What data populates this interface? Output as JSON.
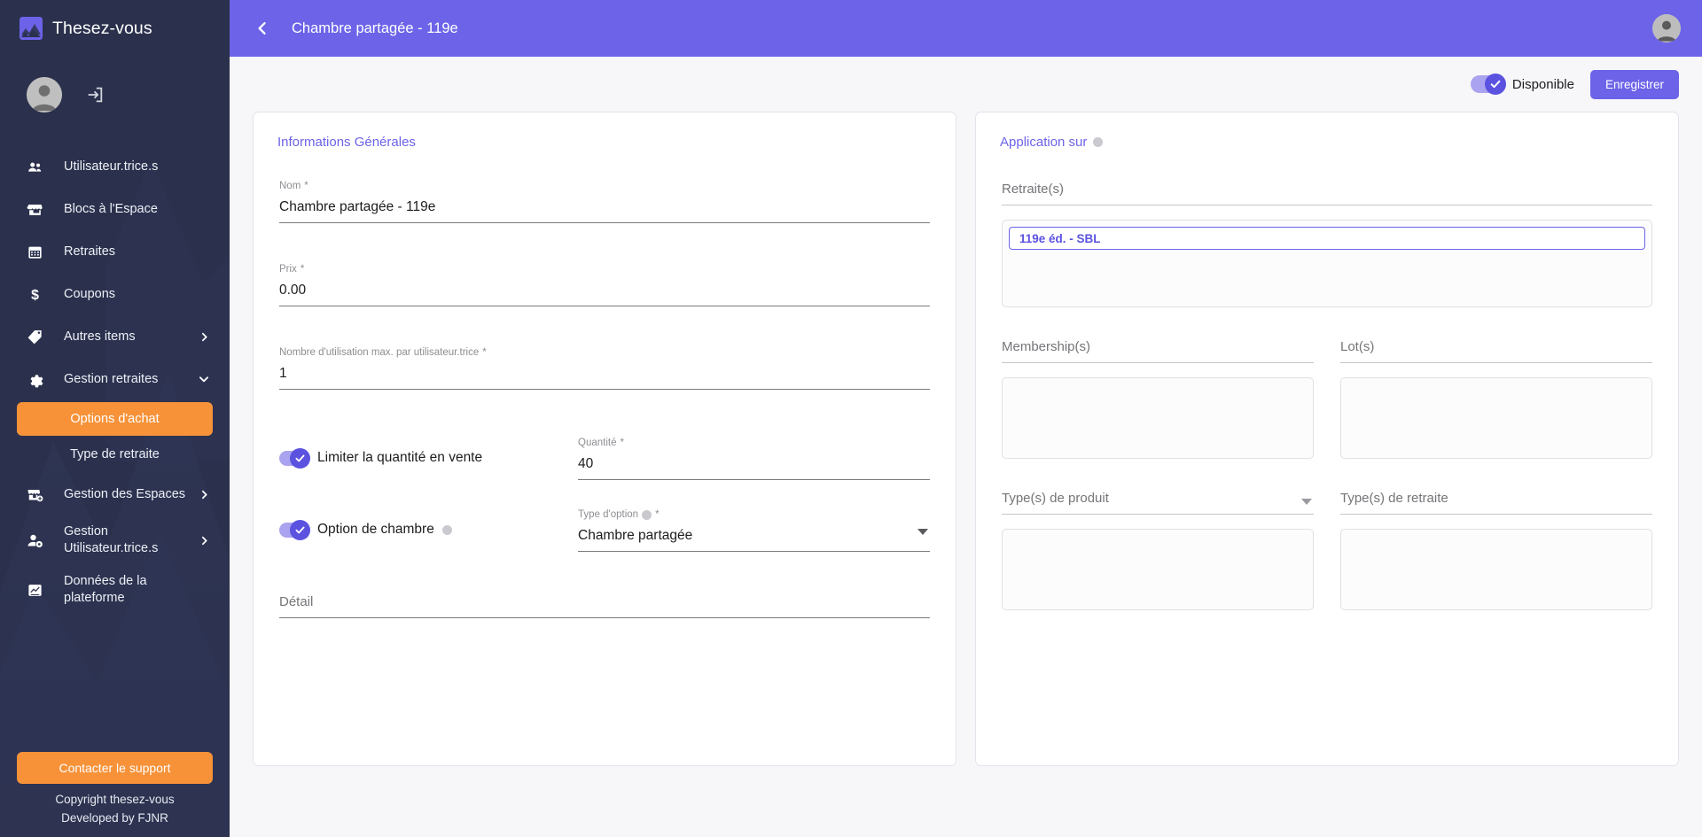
{
  "brand": {
    "name": "Thesez-vous",
    "logo_icon": "mountain-logo-icon"
  },
  "sidebar": {
    "profile": {
      "avatar_icon": "user-avatar-icon",
      "logout_icon": "logout-icon"
    },
    "items": [
      {
        "label": "Utilisateur.trice.s",
        "icon": "people-icon",
        "chevron": ""
      },
      {
        "label": "Blocs à l'Espace",
        "icon": "store-icon",
        "chevron": ""
      },
      {
        "label": "Retraites",
        "icon": "calendar-icon",
        "chevron": ""
      },
      {
        "label": "Coupons",
        "icon": "dollar-icon",
        "chevron": ""
      },
      {
        "label": "Autres items",
        "icon": "tag-icon",
        "chevron": "chevron-right-icon"
      },
      {
        "label": "Gestion retraites",
        "icon": "gear-icon",
        "chevron": "chevron-down-icon"
      }
    ],
    "sub_items": [
      {
        "label": "Options d'achat",
        "active": true
      },
      {
        "label": "Type de retraite",
        "active": false
      }
    ],
    "items_after": [
      {
        "label": "Gestion des Espaces",
        "icon": "store-add-icon",
        "chevron": "chevron-right-icon"
      },
      {
        "label": "Gestion Utilisateur.trice.s",
        "icon": "user-gear-icon",
        "chevron": "chevron-right-icon"
      },
      {
        "label": "Données de la plateforme",
        "icon": "chart-icon",
        "chevron": ""
      }
    ],
    "support_button": "Contacter le support",
    "copyright_line1": "Copyright thesez-vous",
    "copyright_line2": "Developed by FJNR"
  },
  "topbar": {
    "back_icon": "chevron-left-icon",
    "title": "Chambre partagée - 119e",
    "avatar_icon": "user-avatar-icon"
  },
  "actionbar": {
    "availability_label": "Disponible",
    "availability_on": true,
    "save_label": "Enregistrer"
  },
  "left_card": {
    "title": "Informations Générales",
    "fields": [
      {
        "label": "Nom",
        "required": "*",
        "value": "Chambre partagée - 119e"
      },
      {
        "label": "Prix",
        "required": "*",
        "value": "0.00"
      },
      {
        "label": "Nombre d'utilisation max. par utilisateur.trice",
        "required": "*",
        "value": "1"
      }
    ],
    "limit_toggle": {
      "label": "Limiter la quantité en vente",
      "on": true
    },
    "quantity": {
      "label": "Quantité",
      "required": "*",
      "value": "40"
    },
    "room_toggle": {
      "label": "Option de chambre",
      "on": true,
      "info_icon": "info-icon"
    },
    "option_type": {
      "label": "Type d'option",
      "required": "*",
      "info_icon": "info-icon",
      "value": "Chambre partagée",
      "caret_icon": "chevron-down-icon"
    },
    "detail": {
      "placeholder": "Détail",
      "value": ""
    }
  },
  "right_card": {
    "title": "Application sur",
    "title_info_icon": "info-icon",
    "retreats": {
      "placeholder": "Retraite(s)",
      "value": ""
    },
    "retreat_chips": [
      "119e éd. - SBL"
    ],
    "memberships": {
      "placeholder": "Membership(s)",
      "value": "",
      "chips": []
    },
    "lots": {
      "placeholder": "Lot(s)",
      "value": "",
      "chips": []
    },
    "product_types": {
      "placeholder": "Type(s) de produit",
      "value": "",
      "caret_icon": "chevron-down-icon",
      "chips": []
    },
    "retreat_types": {
      "placeholder": "Type(s) de retraite",
      "value": "",
      "chips": []
    }
  },
  "colors": {
    "accent_purple": "#6c63e8",
    "sidebar_bg": "#2b314d",
    "orange": "#f79239",
    "page_bg": "#f7f7f9"
  }
}
